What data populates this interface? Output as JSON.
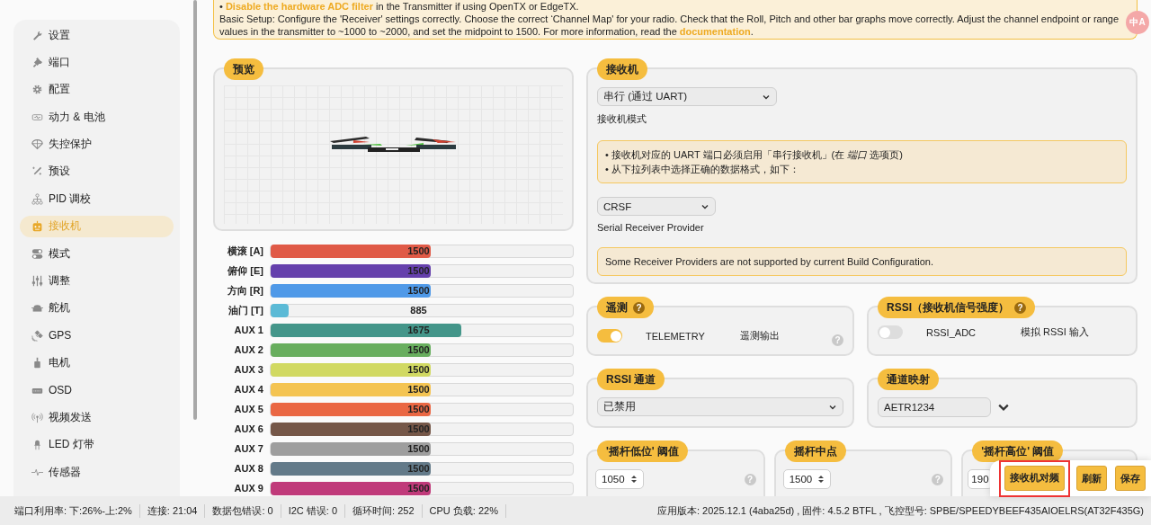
{
  "note": {
    "first_link": "Disable the hardware ADC filter",
    "first_text": " in the Transmitter if using OpenTX or EdgeTX.",
    "bullet": "•",
    "setup_text": "Basic Setup: Configure the 'Receiver' settings correctly. Choose the correct ‘Channel Map' for your radio. Check that the Roll, Pitch and other bar graphs move correctly. Adjust the channel endpoint or range values in the transmitter to ~1000 to ~2000, and set the midpoint to 1500. For more information, read the ",
    "setup_link": "documentation",
    "setup_end": "."
  },
  "extension_badge": "中A",
  "sidebar": {
    "items": [
      {
        "label": "设置",
        "selected": false
      },
      {
        "label": "端口",
        "selected": false
      },
      {
        "label": "配置",
        "selected": false
      },
      {
        "label": "动力 & 电池",
        "selected": false
      },
      {
        "label": "失控保护",
        "selected": false
      },
      {
        "label": "预设",
        "selected": false
      },
      {
        "label": "PID 调校",
        "selected": false
      },
      {
        "label": "接收机",
        "selected": true
      },
      {
        "label": "模式",
        "selected": false
      },
      {
        "label": "调整",
        "selected": false
      },
      {
        "label": "舵机",
        "selected": false
      },
      {
        "label": "GPS",
        "selected": false
      },
      {
        "label": "电机",
        "selected": false
      },
      {
        "label": "OSD",
        "selected": false
      },
      {
        "label": "视频发送",
        "selected": false
      },
      {
        "label": "LED 灯带",
        "selected": false
      },
      {
        "label": "传感器",
        "selected": false
      }
    ]
  },
  "preview": {
    "title": "预览"
  },
  "channels": [
    {
      "name": "横滚 [A]",
      "value": "1500",
      "level": 0.53,
      "color": "#e05a47"
    },
    {
      "name": "俯仰 [E]",
      "value": "1500",
      "level": 0.53,
      "color": "#6540ac"
    },
    {
      "name": "方向 [R]",
      "value": "1500",
      "level": 0.53,
      "color": "#4f99e8"
    },
    {
      "name": "油门 [T]",
      "value": "885",
      "level": 0.06,
      "color": "#5bbad6"
    },
    {
      "name": "AUX 1",
      "value": "1675",
      "level": 0.63,
      "color": "#44968a"
    },
    {
      "name": "AUX 2",
      "value": "1500",
      "level": 0.53,
      "color": "#68ae5e"
    },
    {
      "name": "AUX 3",
      "value": "1500",
      "level": 0.53,
      "color": "#d1d962"
    },
    {
      "name": "AUX 4",
      "value": "1500",
      "level": 0.53,
      "color": "#f4c452"
    },
    {
      "name": "AUX 5",
      "value": "1500",
      "level": 0.53,
      "color": "#ea6743"
    },
    {
      "name": "AUX 6",
      "value": "1500",
      "level": 0.53,
      "color": "#755748"
    },
    {
      "name": "AUX 7",
      "value": "1500",
      "level": 0.53,
      "color": "#9e9e9e"
    },
    {
      "name": "AUX 8",
      "value": "1500",
      "level": 0.53,
      "color": "#637a89"
    },
    {
      "name": "AUX 9",
      "value": "1500",
      "level": 0.53,
      "color": "#c03a7a"
    }
  ],
  "receiver": {
    "title": "接收机",
    "mode_select": "串行 (通过 UART)",
    "mode_label": "接收机模式",
    "notes": [
      "• 接收机对应的 UART 端口必须启用「串行接收机」(在 *端口* 选项页)",
      "• 从下拉列表中选择正确的数据格式，如下："
    ],
    "provider_select": "CRSF",
    "provider_label": "Serial Receiver Provider",
    "warning": "Some Receiver Providers are not supported by current Build Configuration."
  },
  "telemetry": {
    "title": "遥测",
    "title_help": "?",
    "feature": "TELEMETRY",
    "description": "遥测输出",
    "on": true,
    "help": "?"
  },
  "rssi": {
    "title": "RSSI（接收机信号强度）",
    "title_help": "?",
    "feature": "RSSI_ADC",
    "description": "模拟 RSSI 输入",
    "on": false
  },
  "rssi_channel": {
    "title": "RSSI 通道",
    "value": "已禁用"
  },
  "channel_map": {
    "title": "通道映射",
    "value": "AETR1234"
  },
  "thresholds": [
    {
      "title": "'摇杆低位' 阈值",
      "value": "1050",
      "help": "?"
    },
    {
      "title": "摇杆中点",
      "value": "1500",
      "help": "?"
    },
    {
      "title": "'摇杆高位' 阈值",
      "value": "190"
    }
  ],
  "actions": [
    {
      "label": "接收机对频",
      "outlined": true
    },
    {
      "label": "刷新",
      "outlined": false
    },
    {
      "label": "保存",
      "outlined": false
    }
  ],
  "status_bar": {
    "items": [
      "端口利用率: 下:26%-上:2%",
      "连接:  21:04",
      "数据包错误: 0",
      "I2C 错误: 0",
      "循环时间: 252",
      "CPU 负载: 22%"
    ],
    "version": "应用版本: 2025.12.1 (4aba25d) , 固件: 4.5.2 BTFL , 飞控型号: SPBE/SPEEDYBEEF435AIOELRS(AT32F435G)"
  }
}
